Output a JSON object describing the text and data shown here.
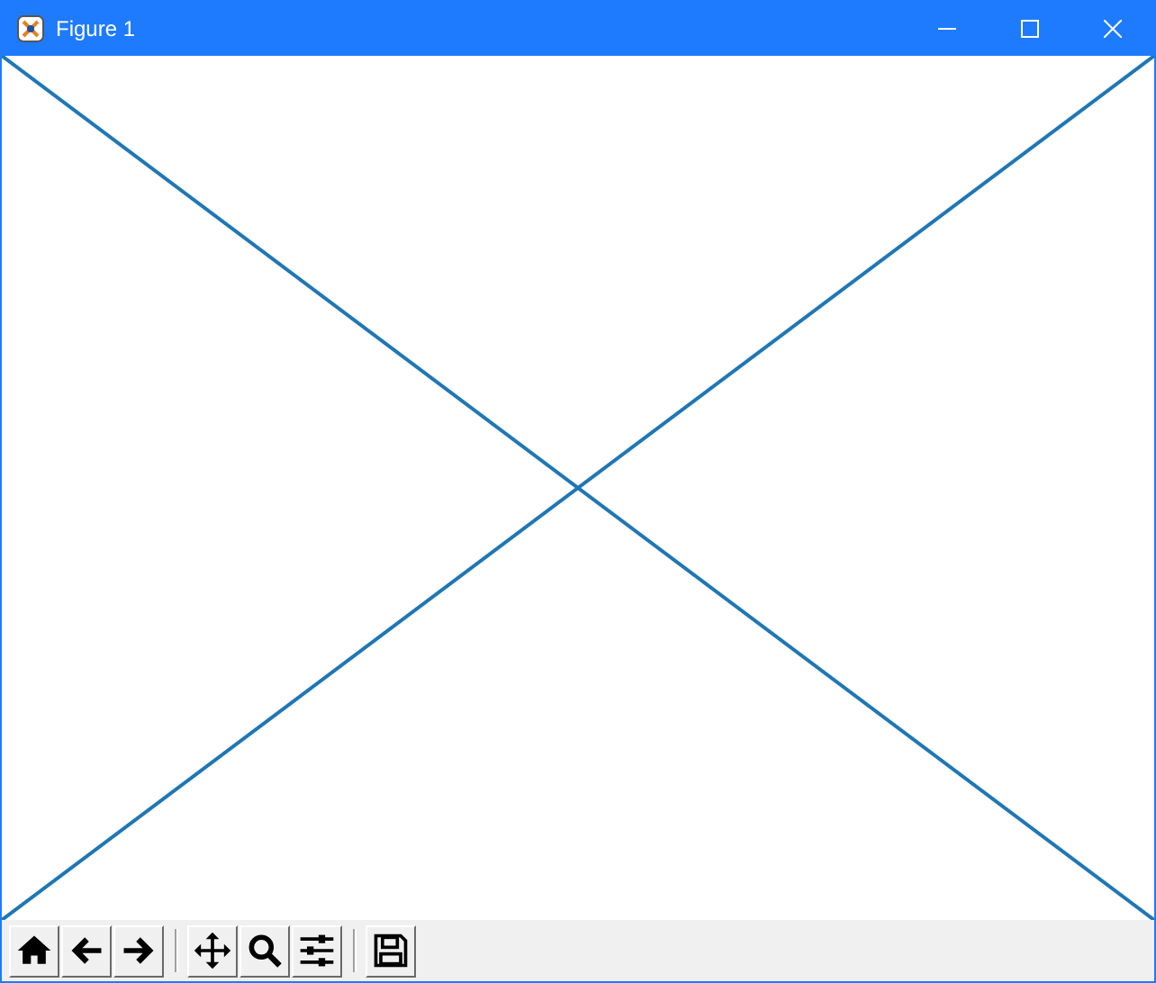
{
  "window": {
    "title": "Figure 1",
    "controls": [
      {
        "kind": "minimize"
      },
      {
        "kind": "maximize"
      },
      {
        "kind": "close"
      }
    ]
  },
  "figure": {
    "kind": "cross-lines"
  },
  "toolbar": {
    "groups": [
      [
        {
          "kind": "home"
        },
        {
          "kind": "back"
        },
        {
          "kind": "forward"
        }
      ],
      [
        {
          "kind": "pan"
        },
        {
          "kind": "zoom"
        },
        {
          "kind": "configure"
        }
      ],
      [
        {
          "kind": "save"
        }
      ]
    ]
  }
}
